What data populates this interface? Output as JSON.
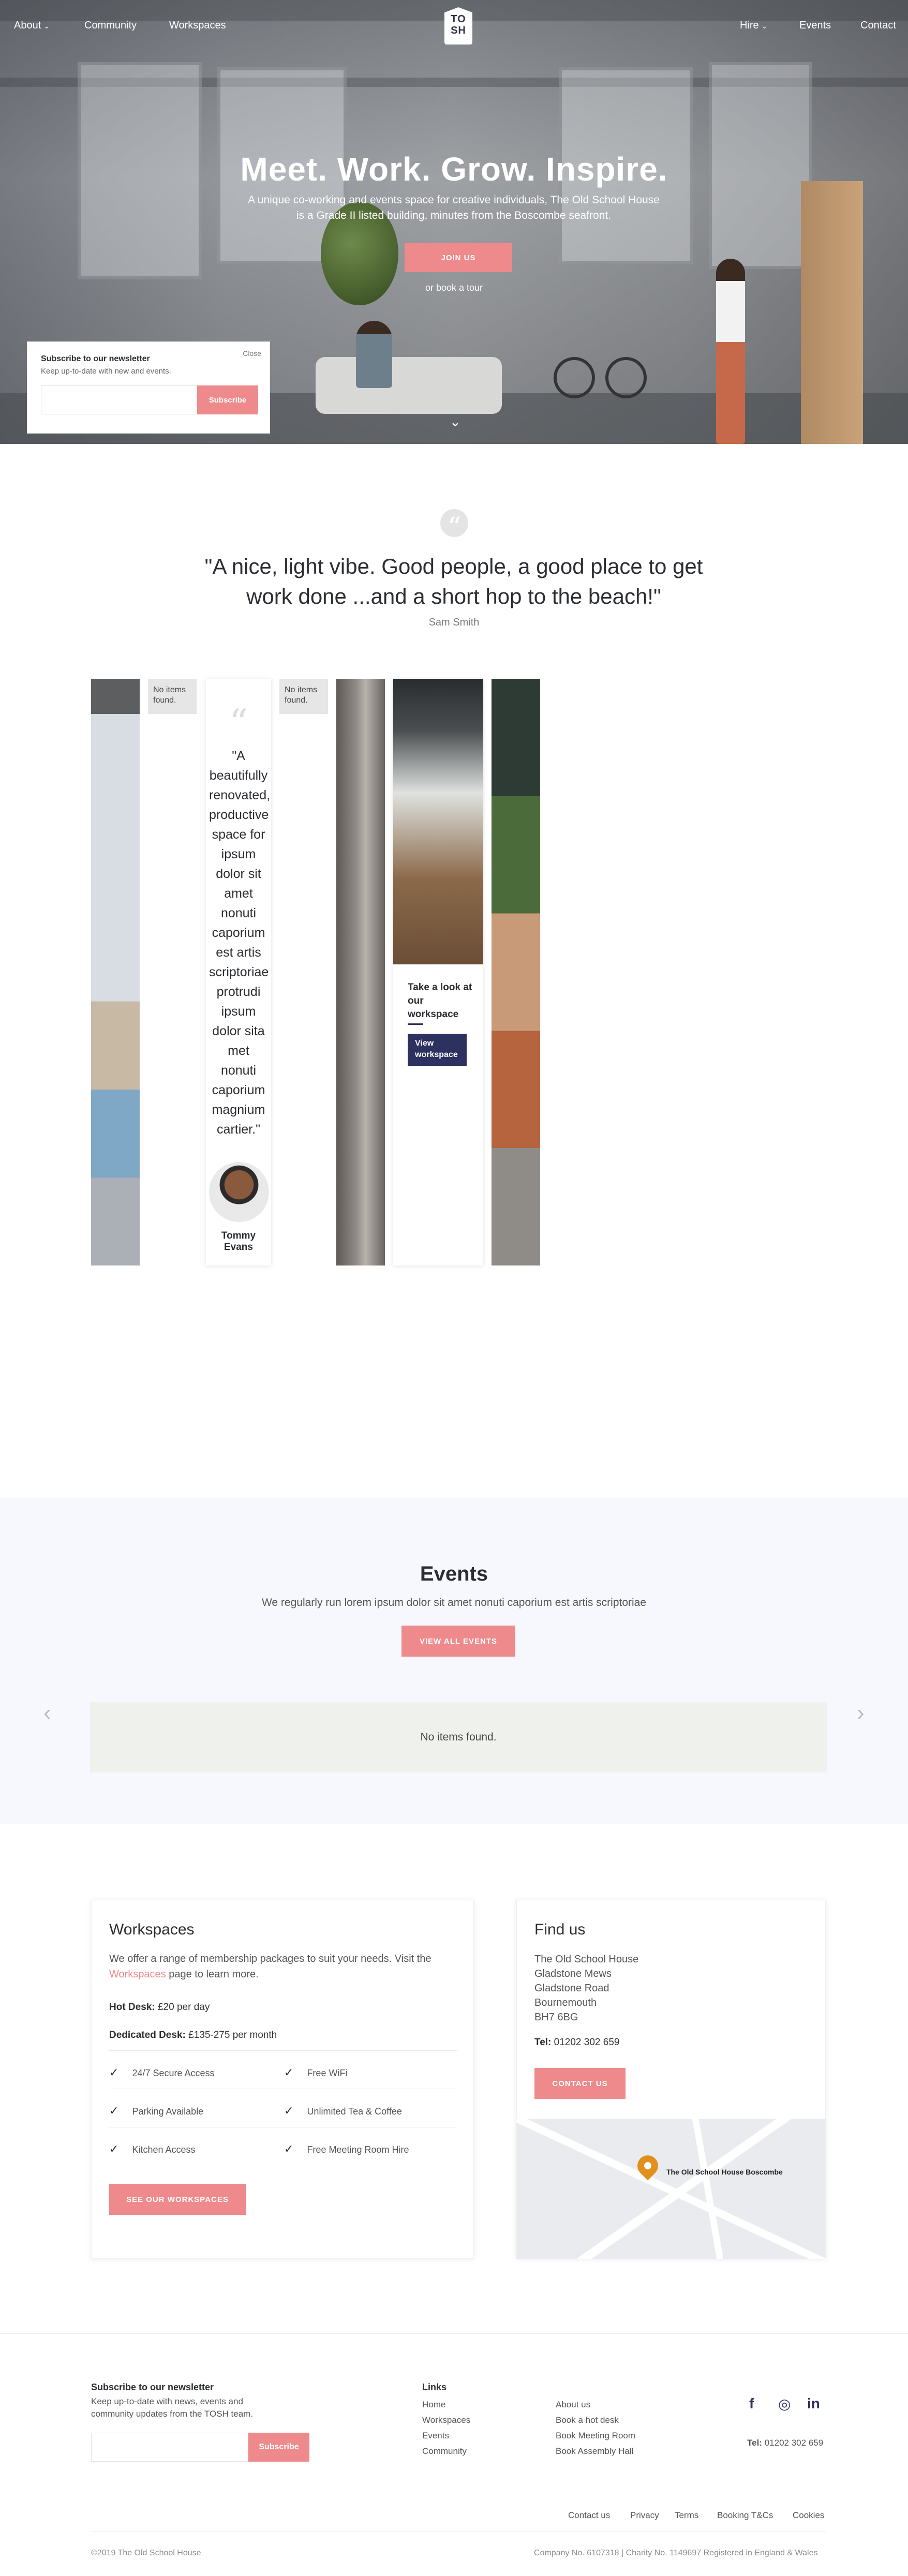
{
  "nav": {
    "left": [
      {
        "label": "About",
        "caret": "⌄"
      },
      {
        "label": "Community"
      },
      {
        "label": "Workspaces"
      }
    ],
    "right": [
      {
        "label": "Hire",
        "caret": "⌄"
      },
      {
        "label": "Events"
      },
      {
        "label": "Contact"
      }
    ],
    "logo": "TO SH"
  },
  "hero": {
    "title": "Meet. Work. Grow. Inspire.",
    "subtitle": "A unique co-working and events space for creative individuals, The Old School House is a Grade II listed building, minutes from the Boscombe seafront.",
    "cta": "JOIN US",
    "tour": "or book a tour",
    "scroll_icon": "chevron-down-icon"
  },
  "newsletter_popup": {
    "title": "Subscribe to our newsletter",
    "text": "Keep up-to-date with new and events.",
    "close": "Close",
    "button": "Subscribe"
  },
  "testimonial": {
    "quote": "\"A nice, light vibe. Good people, a good place to get work done ...and a short hop to the beach!\"",
    "author": "Sam Smith"
  },
  "gallery": {
    "no_items_1": "No items found.",
    "no_items_2": "No items found.",
    "card_quote": "\"A beautifully renovated, productive space for ipsum dolor sit amet nonuti caporium est artis scriptoriae protrudi ipsum dolor sita met nonuti caporium magnium cartier.\"",
    "card_author": "Tommy Evans",
    "ws_title": "Take a look at our workspace",
    "ws_button": "View workspace"
  },
  "events": {
    "title": "Events",
    "subtitle": "We regularly run lorem ipsum dolor sit amet nonuti caporium est artis scriptoriae",
    "button": "VIEW ALL EVENTS",
    "empty": "No items found.",
    "prev": "‹",
    "next": "›"
  },
  "workspaces": {
    "title": "Workspaces",
    "text_before": "We offer a range of membership packages to suit your needs. Visit the",
    "link": "Workspaces",
    "text_after": "page to learn more.",
    "hot_label": "Hot Desk:",
    "hot_value": "£20 per day",
    "ded_label": "Dedicated Desk:",
    "ded_value": "£135-275 per month",
    "features": [
      "24/7 Secure Access",
      "Free WiFi",
      "Parking Available",
      "Unlimited Tea & Coffee",
      "Kitchen Access",
      "Free Meeting Room Hire"
    ],
    "button": "SEE OUR WORKSPACES"
  },
  "findus": {
    "title": "Find us",
    "address": [
      "The Old School House",
      "Gladstone Mews",
      "Gladstone Road",
      "Bournemouth",
      "BH7 6BG"
    ],
    "tel_label": "Tel:",
    "tel": "01202 302 659",
    "button": "CONTACT US",
    "map_label": "The Old School House Boscombe"
  },
  "footer": {
    "news_title": "Subscribe to our newsletter",
    "news_text": "Keep up-to-date with news, events and community updates from the TOSH team.",
    "subscribe": "Subscribe",
    "links_title": "Links",
    "links_col1": [
      "Home",
      "Workspaces",
      "Events",
      "Community"
    ],
    "links_col2": [
      "About us",
      "Book a hot desk",
      "Book Meeting Room",
      "Book Assembly Hall"
    ],
    "social": [
      "f",
      "◎",
      "in"
    ],
    "tel_label": "Tel:",
    "tel": "01202 302 659",
    "bottom_links": [
      "Contact us",
      "Privacy",
      "Terms",
      "Booking T&Cs",
      "Cookies"
    ],
    "copyright": "©2019 The Old School House",
    "company": "Company No. 6107318  |  Charity No. 1149697 Registered in England & Wales"
  }
}
